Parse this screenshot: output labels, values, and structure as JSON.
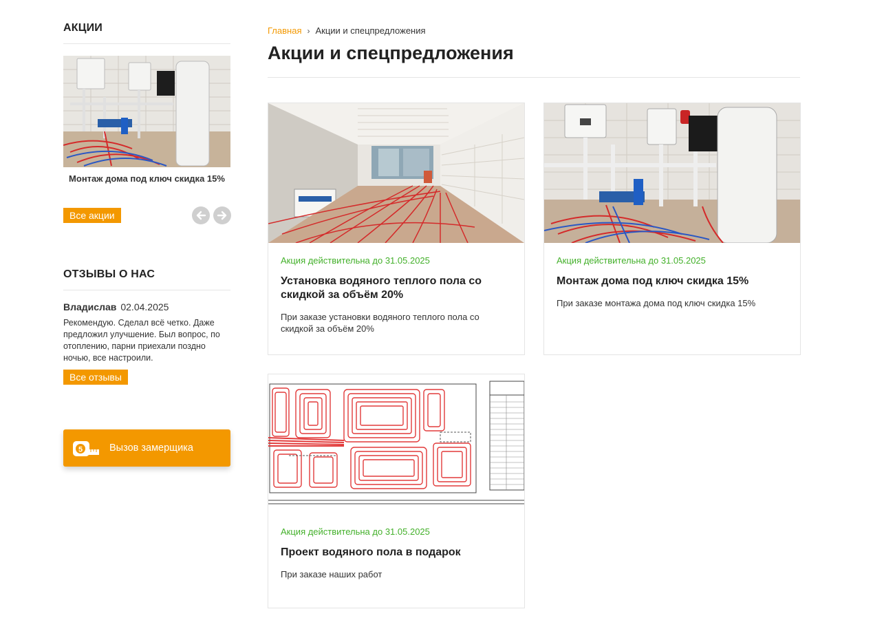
{
  "sidebar": {
    "promos_heading": "АКЦИИ",
    "promo_caption": "Монтаж дома под ключ скидка 15%",
    "all_promos_label": "Все акции",
    "reviews_heading": "ОТЗЫВЫ О НАС",
    "review": {
      "author": "Владислав",
      "date": "02.04.2025",
      "text": "Рекомендую. Сделал всё четко. Даже предложил улучшение. Был вопрос, по отоплению, парни приехали поздно ночью, все настроили."
    },
    "all_reviews_label": "Все отзывы",
    "call_button_label": "Вызов замерщика",
    "call_button_icon": "measuring-tape-icon"
  },
  "breadcrumb": {
    "home": "Главная",
    "separator": "›",
    "current": "Акции и спецпредложения"
  },
  "page_title": "Акции и спецпредложения",
  "cards": [
    {
      "validity": "Акция действительна до 31.05.2025",
      "title": "Установка водяного теплого пола со скидкой за объём 20%",
      "description": "При заказе установки водяного теплого пола со скидкой за объём 20%"
    },
    {
      "validity": "Акция действительна до 31.05.2025",
      "title": "Монтаж дома под ключ скидка 15%",
      "description": "При заказе монтажа дома под ключ скидка 15%"
    },
    {
      "validity": "Акция действительна до 31.05.2025",
      "title": "Проект водяного пола в подарок",
      "description": "При заказе наших работ"
    }
  ],
  "colors": {
    "accent": "#f39800",
    "validity_green": "#43b02a"
  }
}
